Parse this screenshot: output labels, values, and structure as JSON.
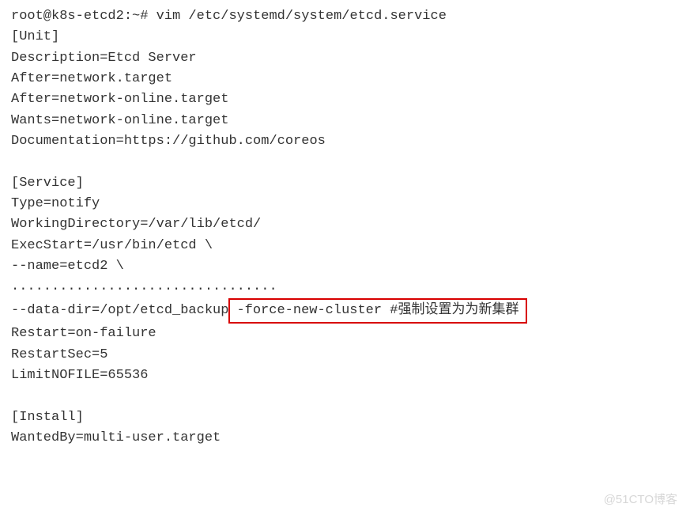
{
  "lines": {
    "l1": "root@k8s-etcd2:~# vim /etc/systemd/system/etcd.service",
    "l2": "[Unit]",
    "l3": "Description=Etcd Server",
    "l4": "After=network.target",
    "l5": "After=network-online.target",
    "l6": "Wants=network-online.target",
    "l7": "Documentation=https://github.com/coreos",
    "l8": "[Service]",
    "l9": "Type=notify",
    "l10": "WorkingDirectory=/var/lib/etcd/",
    "l11": "ExecStart=/usr/bin/etcd  \\",
    "l12": "  --name=etcd2 \\",
    "l13": ".................................",
    "l14a": "  --data-dir=/opt/etcd_backup ",
    "l14b": "-force-new-cluster #强制设置为为新集群",
    "l15": "Restart=on-failure",
    "l16": "RestartSec=5",
    "l17": "LimitNOFILE=65536",
    "l18": "[Install]",
    "l19": "WantedBy=multi-user.target"
  },
  "watermark": "@51CTO博客",
  "highlight_color": "#d80000"
}
